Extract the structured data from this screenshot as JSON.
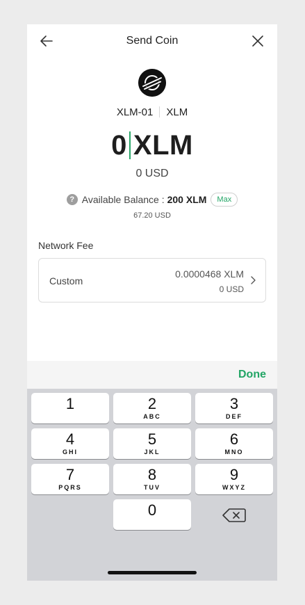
{
  "header": {
    "title": "Send Coin",
    "back_icon": "arrow-left-icon",
    "close_icon": "close-icon"
  },
  "coin": {
    "logo_icon": "stellar-logo-icon",
    "account": "XLM-01",
    "symbol": "XLM"
  },
  "amount": {
    "value": "0",
    "unit": "XLM",
    "usd": "0 USD"
  },
  "balance": {
    "label": "Available Balance :",
    "value": "200 XLM",
    "max_label": "Max",
    "usd": "67.20 USD"
  },
  "network_fee": {
    "label": "Network Fee",
    "name": "Custom",
    "amount": "0.0000468 XLM",
    "usd": "0 USD"
  },
  "keyboard": {
    "done_label": "Done",
    "keys": [
      {
        "num": "1",
        "letters": ""
      },
      {
        "num": "2",
        "letters": "ABC"
      },
      {
        "num": "3",
        "letters": "DEF"
      },
      {
        "num": "4",
        "letters": "GHI"
      },
      {
        "num": "5",
        "letters": "JKL"
      },
      {
        "num": "6",
        "letters": "MNO"
      },
      {
        "num": "7",
        "letters": "PQRS"
      },
      {
        "num": "8",
        "letters": "TUV"
      },
      {
        "num": "9",
        "letters": "WXYZ"
      },
      {
        "num": "0",
        "letters": ""
      }
    ],
    "backspace_icon": "backspace-icon"
  },
  "colors": {
    "accent": "#22a565",
    "keypad_bg": "#d2d3d7"
  }
}
